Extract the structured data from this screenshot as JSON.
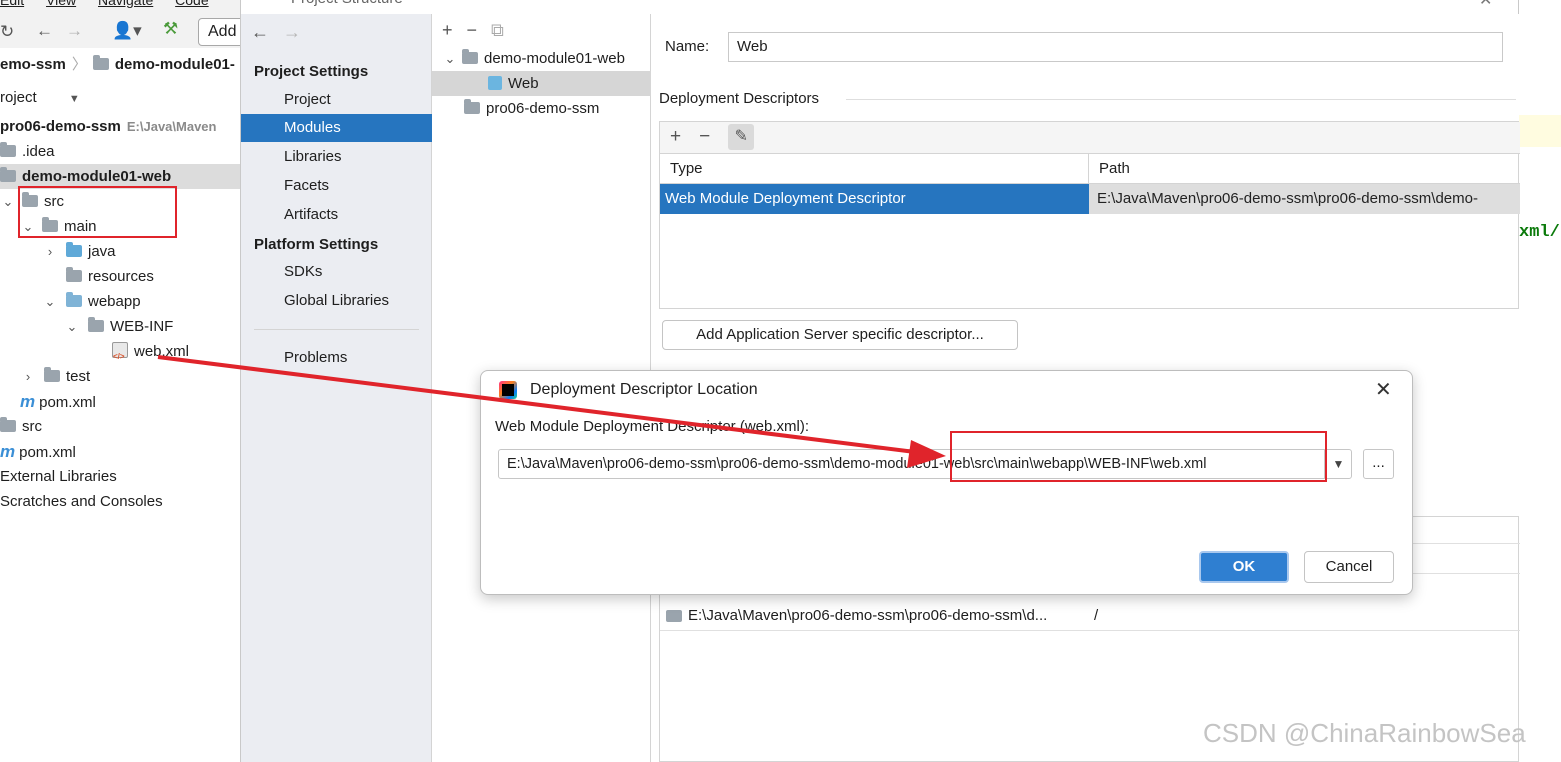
{
  "ide": {
    "menu": [
      "Edit",
      "View",
      "Navigate",
      "Code"
    ],
    "toolbar_add_label": "Add",
    "breadcrumb": [
      "emo-ssm",
      "demo-module01-"
    ],
    "project_panel_label": "roject",
    "tree": [
      {
        "label": "pro06-demo-ssm",
        "path": "E:\\Java\\Maven"
      },
      {
        "label": ".idea"
      },
      {
        "label": "demo-module01-web"
      },
      {
        "label": "src"
      },
      {
        "label": "main"
      },
      {
        "label": "java"
      },
      {
        "label": "resources"
      },
      {
        "label": "webapp"
      },
      {
        "label": "WEB-INF"
      },
      {
        "label": "web.xml"
      },
      {
        "label": "test"
      },
      {
        "label": "pom.xml"
      },
      {
        "label": "src"
      },
      {
        "label": "pom.xml"
      },
      {
        "label": "External Libraries"
      },
      {
        "label": "Scratches and Consoles"
      }
    ],
    "editor_snippet": "xml/"
  },
  "project_structure": {
    "title": "Project Structure",
    "project_settings_header": "Project Settings",
    "project_settings_items": [
      "Project",
      "Modules",
      "Libraries",
      "Facets",
      "Artifacts"
    ],
    "platform_settings_header": "Platform Settings",
    "platform_settings_items": [
      "SDKs",
      "Global Libraries"
    ],
    "problems_label": "Problems",
    "modules_tree": [
      "demo-module01-web",
      "Web",
      "pro06-demo-ssm"
    ],
    "name_label": "Name:",
    "name_value": "Web",
    "deployment_descriptors_title": "Deployment Descriptors",
    "table_headers": [
      "Type",
      "Path"
    ],
    "table_row_type": "Web Module Deployment Descriptor",
    "table_row_path": "E:\\Java\\Maven\\pro06-demo-ssm\\pro06-demo-ssm\\demo-",
    "add_server_button": "Add Application Server specific descriptor...",
    "lower_row_path": "E:\\Java\\Maven\\pro06-demo-ssm\\pro06-demo-ssm\\d...",
    "lower_row_rel": "/"
  },
  "ddl_dialog": {
    "title": "Deployment Descriptor Location",
    "label": "Web Module Deployment Descriptor (web.xml):",
    "value": "E:\\Java\\Maven\\pro06-demo-ssm\\pro06-demo-ssm\\demo-module01-web\\src\\main\\webapp\\WEB-INF\\web.xml",
    "browse_label": "...",
    "ok_label": "OK",
    "cancel_label": "Cancel"
  },
  "watermark": "CSDN @ChinaRainbowSea",
  "colors": {
    "selection": "#2675bf",
    "annotation_red": "#e0242b",
    "ok_button": "#2f7fd1"
  }
}
